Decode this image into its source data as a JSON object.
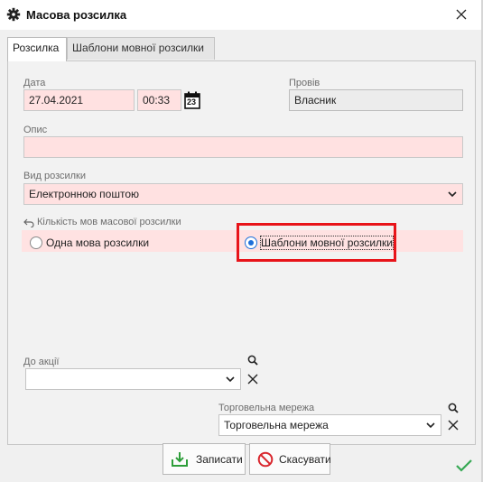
{
  "window": {
    "title": "Масова розсилка"
  },
  "tabs": [
    {
      "label": "Розсилка",
      "active": true
    },
    {
      "label": "Шаблони мовної розсилки",
      "active": false
    }
  ],
  "form": {
    "date_label": "Дата",
    "date_value": "27.04.2021",
    "time_value": "00:33",
    "calendar_day": "23",
    "conducted_label": "Провів",
    "conducted_value": "Власник",
    "description_label": "Опис",
    "description_value": "",
    "type_label": "Вид розсилки",
    "type_value": "Електронною поштою",
    "langs_label": "Кількість мов масової розсилки",
    "radio_single": "Одна мова розсилки",
    "radio_templates": "Шаблони мовної розсилки",
    "selected_radio": "templates",
    "promo_label": "До акції",
    "promo_value": "",
    "network_label": "Торговельна мережа",
    "network_value": "Торговельна мережа"
  },
  "buttons": {
    "save": "Записати",
    "cancel": "Скасувати"
  },
  "colors": {
    "required_field": "#ffe1e1",
    "highlight": "#e8141a",
    "radio_accent": "#1e6fd9",
    "save_icon": "#2e9e3a",
    "cancel_icon": "#d9262d",
    "check": "#35a853"
  }
}
